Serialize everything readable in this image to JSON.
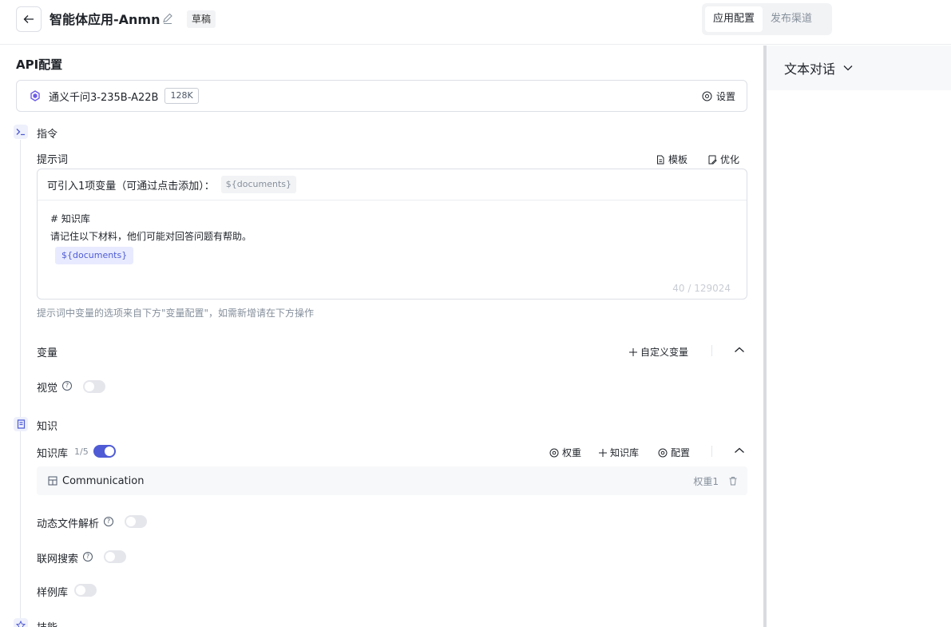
{
  "header": {
    "title": "智能体应用-Anmn",
    "status": "草稿",
    "tabs": [
      "应用配置",
      "发布渠道"
    ]
  },
  "api": {
    "section_title": "API配置",
    "model_name": "通义千问3-235B-A22B",
    "context": "128K",
    "settings_label": "设置"
  },
  "instruction": {
    "title": "指令",
    "prompt_label": "提示词",
    "template_label": "模板",
    "optimize_label": "优化",
    "hint": "可引入1项变量（可通过点击添加）：",
    "hint_var": "${documents}",
    "body_line1": "# 知识库",
    "body_line2": "请记住以下材料，他们可能对回答问题有帮助。",
    "body_var": "${documents}",
    "counter": "40 / 129024",
    "note": "提示词中变量的选项来自下方\"变量配置\"，如需新增请在下方操作",
    "variables_label": "变量",
    "custom_var_label": "自定义变量",
    "vision_label": "视觉"
  },
  "knowledge": {
    "title": "知识",
    "kb_label": "知识库",
    "kb_count": "1/5",
    "weight_label": "权重",
    "add_kb_label": "知识库",
    "config_label": "配置",
    "item_name": "Communication",
    "item_weight": "权重1",
    "dynamic_parse_label": "动态文件解析",
    "web_search_label": "联网搜索",
    "sample_lib_label": "样例库"
  },
  "skills": {
    "title": "技能"
  },
  "right_panel": {
    "mode_label": "文本对话"
  },
  "toggles": {
    "vision": false,
    "kb": true,
    "dynamic_parse": false,
    "web_search": false,
    "sample_lib": false
  },
  "colors": {
    "accent": "#4f5bd5",
    "border": "#dcdfe6"
  }
}
